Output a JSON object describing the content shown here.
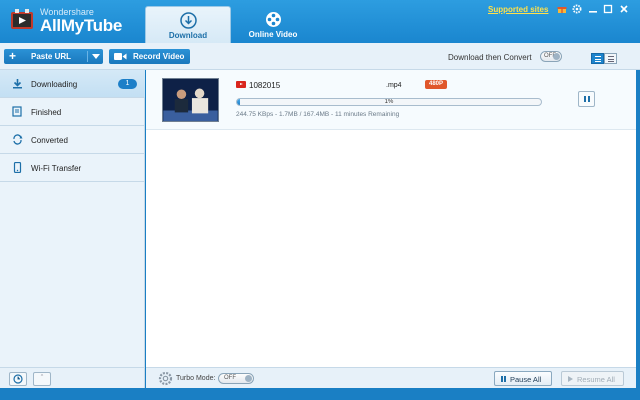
{
  "app": {
    "vendor": "Wondershare",
    "name": "AllMyTube"
  },
  "tabs": [
    {
      "label": "Download",
      "icon": "download-circle-icon",
      "active": true
    },
    {
      "label": "Online Video",
      "icon": "film-reel-icon",
      "active": false
    }
  ],
  "titlebar": {
    "supported_sites": "Supported sites",
    "icons": [
      "gift-icon",
      "gear-icon",
      "minimize-icon",
      "maximize-icon",
      "close-icon"
    ]
  },
  "toolbar": {
    "paste_url": "Paste URL",
    "record_video": "Record Video",
    "download_then_convert": "Download then Convert",
    "download_then_convert_state": "OFF"
  },
  "sidebar": {
    "items": [
      {
        "label": "Downloading",
        "icon": "download-icon",
        "count": "1",
        "active": true
      },
      {
        "label": "Finished",
        "icon": "finished-list-icon"
      },
      {
        "label": "Converted",
        "icon": "converted-icon"
      },
      {
        "label": "Wi-Fi Transfer",
        "icon": "phone-icon"
      }
    ]
  },
  "download": {
    "title": "1082015",
    "format": ".mp4",
    "resolution": "480P",
    "progress_text": "1%",
    "progress": 0.01,
    "stats": "244.75 KBps - 1.7MB / 167.4MB - 11 minutes Remaining"
  },
  "footer": {
    "turbo_mode": "Turbo Mode:",
    "turbo_state": "OFF",
    "pause_all": "Pause All",
    "resume_all": "Resume All"
  },
  "colors": {
    "accent": "#1a7fc4",
    "badge": "#e0572b",
    "link": "#ffe14a"
  }
}
